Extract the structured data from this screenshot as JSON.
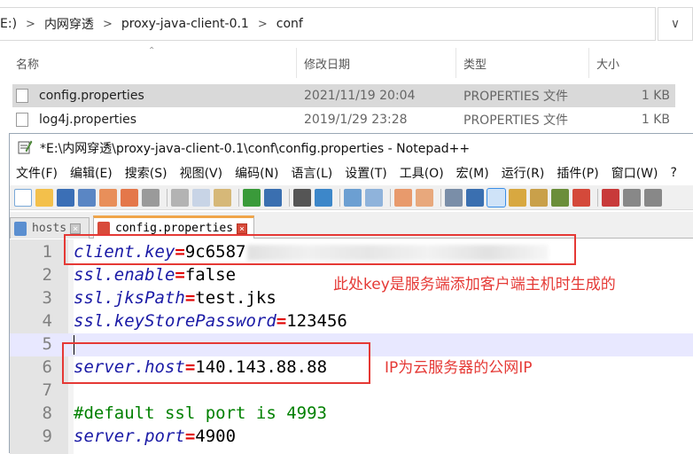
{
  "explorer": {
    "breadcrumb": [
      "E:)",
      "内网穿透",
      "proxy-java-client-0.1",
      "conf"
    ],
    "columns": {
      "name": "名称",
      "modified": "修改日期",
      "type": "类型",
      "size": "大小"
    },
    "files": [
      {
        "name": "config.properties",
        "date": "2021/11/19 20:04",
        "type": "PROPERTIES 文件",
        "size": "1 KB",
        "selected": true
      },
      {
        "name": "log4j.properties",
        "date": "2019/1/29 23:28",
        "type": "PROPERTIES 文件",
        "size": "1 KB",
        "selected": false
      }
    ]
  },
  "notepad": {
    "title": "*E:\\内网穿透\\proxy-java-client-0.1\\conf\\config.properties - Notepad++",
    "menu": [
      "文件(F)",
      "编辑(E)",
      "搜索(S)",
      "视图(V)",
      "编码(N)",
      "语言(L)",
      "设置(T)",
      "工具(O)",
      "宏(M)",
      "运行(R)",
      "插件(P)",
      "窗口(W)",
      "?"
    ],
    "tabs": [
      {
        "label": "hosts",
        "active": false
      },
      {
        "label": "config.properties",
        "active": true
      }
    ],
    "lines": [
      {
        "n": "1",
        "key": "client.key",
        "eq": "=",
        "value": "9c6587",
        "redacted": true
      },
      {
        "n": "2",
        "key": "ssl.enable",
        "eq": "=",
        "value": "false"
      },
      {
        "n": "3",
        "key": "ssl.jksPath",
        "eq": "=",
        "value": "test.jks"
      },
      {
        "n": "4",
        "key": "ssl.keyStorePassword",
        "eq": "=",
        "value": "123456"
      },
      {
        "n": "5",
        "key": "",
        "eq": "",
        "value": "",
        "current": true
      },
      {
        "n": "6",
        "key": "server.host",
        "eq": "=",
        "value": "140.143.88.88"
      },
      {
        "n": "7",
        "key": "",
        "eq": "",
        "value": ""
      },
      {
        "n": "8",
        "comment": "#default ssl port is 4993"
      },
      {
        "n": "9",
        "key": "server.port",
        "eq": "=",
        "value": "4900"
      }
    ]
  },
  "annotations": {
    "key_note": "此处key是服务端添加客户端主机时生成的",
    "ip_note": "IP为云服务器的公网IP"
  },
  "colors": {
    "annotation": "#e53935",
    "key": "#1a1aa6",
    "operator": "#e00000",
    "comment": "#008000"
  }
}
